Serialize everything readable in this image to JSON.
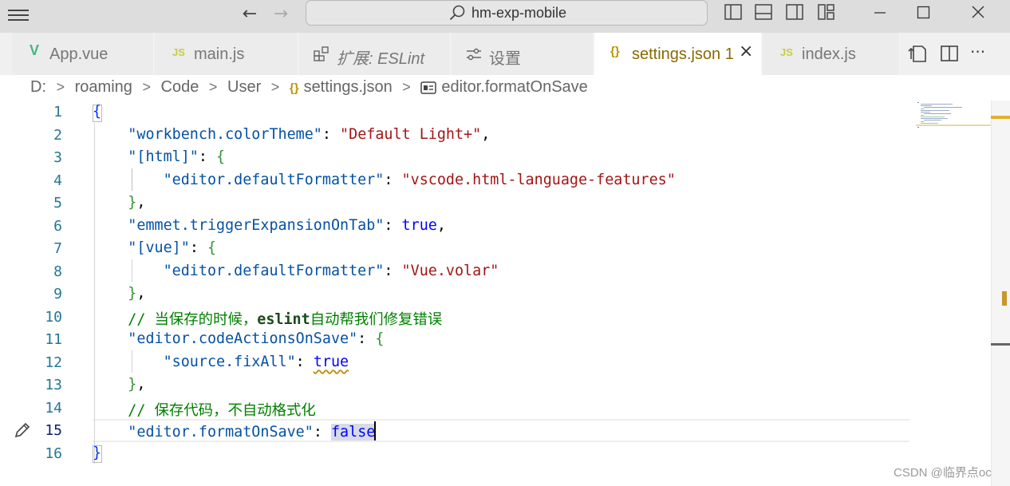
{
  "window": {
    "search_text": "hm-exp-mobile",
    "nav_back": "←",
    "nav_forward": "→"
  },
  "tabs": [
    {
      "icon": "V",
      "icon_color": "#41b883",
      "label": "App.vue",
      "active": false
    },
    {
      "icon": "JS",
      "icon_color": "#cbcb41",
      "label": "main.js",
      "active": false
    },
    {
      "icon": "⊞",
      "icon_color": "#666666",
      "label": "扩展: ESLint",
      "active": false
    },
    {
      "icon": "⚙",
      "icon_color": "#666666",
      "label": "设置",
      "active": false
    },
    {
      "icon": "{}",
      "icon_color": "#b89500",
      "label": "settings.json 1",
      "active": true
    },
    {
      "icon": "JS",
      "icon_color": "#cbcb41",
      "label": "index.js",
      "active": false
    }
  ],
  "tab_close_glyph": "×",
  "tab_more_glyph": "···",
  "breadcrumb": {
    "items": [
      "D:",
      "roaming",
      "Code",
      "User",
      "settings.json",
      "editor.formatOnSave"
    ],
    "separator": ">",
    "json_icon": "{}"
  },
  "editor": {
    "line_numbers": [
      "1",
      "2",
      "3",
      "4",
      "5",
      "6",
      "7",
      "8",
      "9",
      "10",
      "11",
      "12",
      "13",
      "14",
      "15",
      "16"
    ],
    "current_line": 15,
    "lines": {
      "l1_open": "{",
      "l2_key": "\"workbench.colorTheme\"",
      "l2_val": "\"Default Light+\"",
      "l3_key": "\"[html]\"",
      "l3_open": "{",
      "l4_key": "\"editor.defaultFormatter\"",
      "l4_val": "\"vscode.html-language-features\"",
      "l5_close": "}",
      "l6_key": "\"emmet.triggerExpansionOnTab\"",
      "l6_val": "true",
      "l7_key": "\"[vue]\"",
      "l7_open": "{",
      "l8_key": "\"editor.defaultFormatter\"",
      "l8_val": "\"Vue.volar\"",
      "l9_close": "}",
      "l10_comment_a": "// 当保存的时候，",
      "l10_comment_b": "eslint",
      "l10_comment_c": "自动帮我们修复错误",
      "l11_key": "\"editor.codeActionsOnSave\"",
      "l11_open": "{",
      "l12_key": "\"source.fixAll\"",
      "l12_val": "true",
      "l13_close": "}",
      "l14_comment": "// 保存代码，不自动格式化",
      "l15_key": "\"editor.formatOnSave\"",
      "l15_val_a": "fal",
      "l15_val_b": "se",
      "l16_close": "}"
    }
  },
  "watermark": "CSDN @临界点oc"
}
